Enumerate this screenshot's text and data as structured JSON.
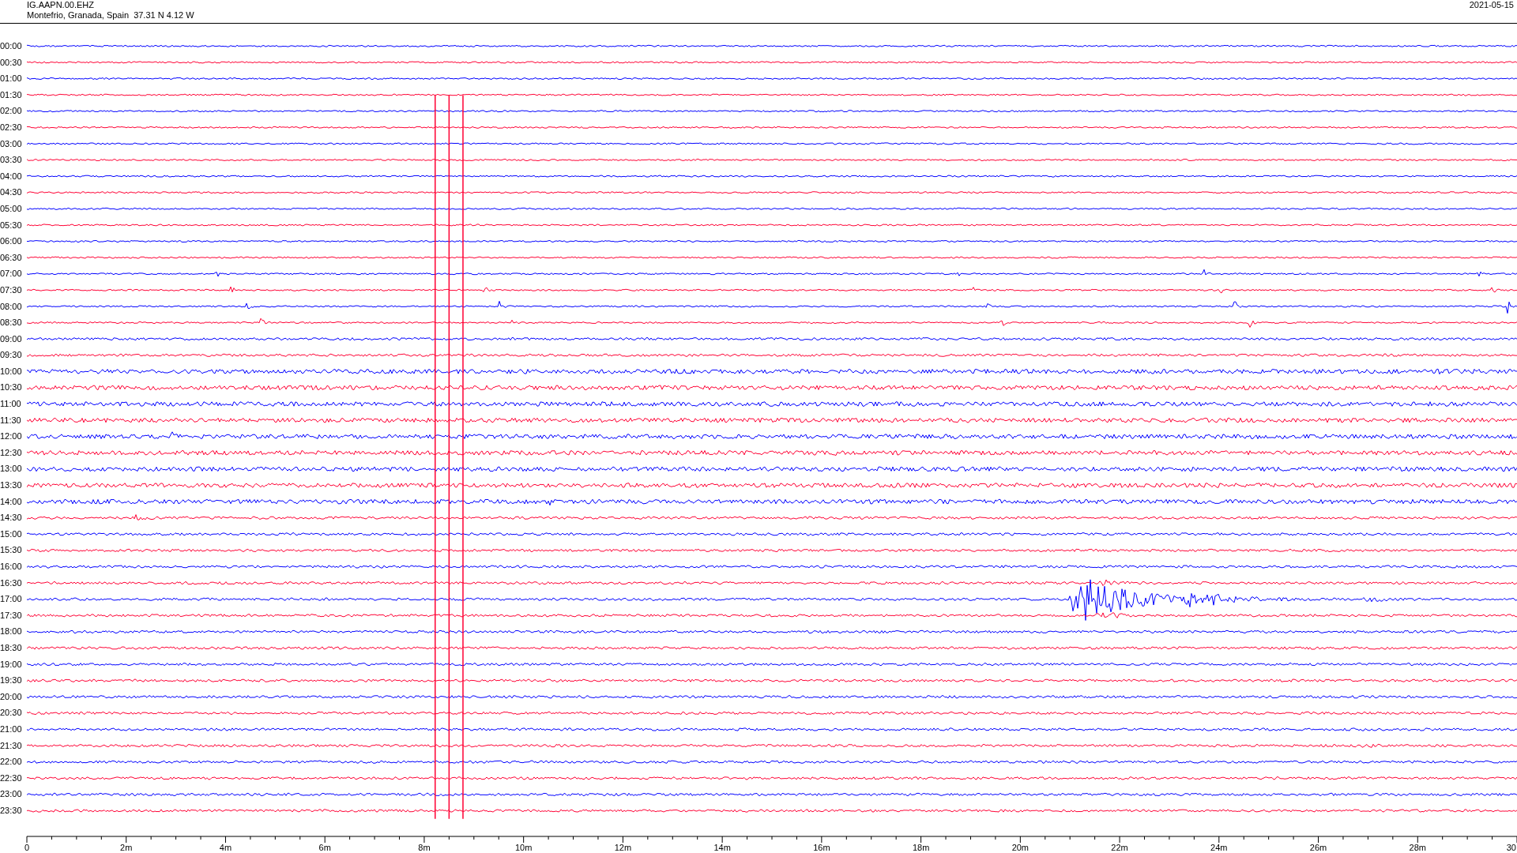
{
  "header": {
    "station": "IG.AAPN.00.EHZ",
    "location": "Montefrio, Granada, Spain  37.31 N 4.12 W",
    "date": "2021-05-15"
  },
  "rows": [
    {
      "label": "00:00",
      "color": "#0000ff"
    },
    {
      "label": "00:30",
      "color": "#ff0033"
    },
    {
      "label": "01:00",
      "color": "#0000ff"
    },
    {
      "label": "01:30",
      "color": "#ff0033"
    },
    {
      "label": "02:00",
      "color": "#0000ff"
    },
    {
      "label": "02:30",
      "color": "#ff0033"
    },
    {
      "label": "03:00",
      "color": "#0000ff"
    },
    {
      "label": "03:30",
      "color": "#ff0033"
    },
    {
      "label": "04:00",
      "color": "#0000ff"
    },
    {
      "label": "04:30",
      "color": "#ff0033"
    },
    {
      "label": "05:00",
      "color": "#0000ff"
    },
    {
      "label": "05:30",
      "color": "#ff0033"
    },
    {
      "label": "06:00",
      "color": "#0000ff"
    },
    {
      "label": "06:30",
      "color": "#ff0033"
    },
    {
      "label": "07:00",
      "color": "#0000ff"
    },
    {
      "label": "07:30",
      "color": "#ff0033"
    },
    {
      "label": "08:00",
      "color": "#0000ff"
    },
    {
      "label": "08:30",
      "color": "#ff0033"
    },
    {
      "label": "09:00",
      "color": "#0000ff"
    },
    {
      "label": "09:30",
      "color": "#ff0033"
    },
    {
      "label": "10:00",
      "color": "#0000ff"
    },
    {
      "label": "10:30",
      "color": "#ff0033"
    },
    {
      "label": "11:00",
      "color": "#0000ff"
    },
    {
      "label": "11:30",
      "color": "#ff0033"
    },
    {
      "label": "12:00",
      "color": "#0000ff"
    },
    {
      "label": "12:30",
      "color": "#ff0033"
    },
    {
      "label": "13:00",
      "color": "#0000ff"
    },
    {
      "label": "13:30",
      "color": "#ff0033"
    },
    {
      "label": "14:00",
      "color": "#0000ff"
    },
    {
      "label": "14:30",
      "color": "#ff0033"
    },
    {
      "label": "15:00",
      "color": "#0000ff"
    },
    {
      "label": "15:30",
      "color": "#ff0033"
    },
    {
      "label": "16:00",
      "color": "#0000ff"
    },
    {
      "label": "16:30",
      "color": "#ff0033"
    },
    {
      "label": "17:00",
      "color": "#0000ff"
    },
    {
      "label": "17:30",
      "color": "#ff0033"
    },
    {
      "label": "18:00",
      "color": "#0000ff"
    },
    {
      "label": "18:30",
      "color": "#ff0033"
    },
    {
      "label": "19:00",
      "color": "#0000ff"
    },
    {
      "label": "19:30",
      "color": "#ff0033"
    },
    {
      "label": "20:00",
      "color": "#0000ff"
    },
    {
      "label": "20:30",
      "color": "#ff0033"
    },
    {
      "label": "21:00",
      "color": "#0000ff"
    },
    {
      "label": "21:30",
      "color": "#ff0033"
    },
    {
      "label": "22:00",
      "color": "#0000ff"
    },
    {
      "label": "22:30",
      "color": "#ff0033"
    },
    {
      "label": "23:00",
      "color": "#0000ff"
    },
    {
      "label": "23:30",
      "color": "#ff0033"
    }
  ],
  "axis": {
    "labels": [
      "0",
      "2m",
      "4m",
      "6m",
      "8m",
      "10m",
      "12m",
      "14m",
      "16m",
      "18m",
      "20m",
      "22m",
      "24m",
      "26m",
      "28m",
      "30"
    ]
  }
}
